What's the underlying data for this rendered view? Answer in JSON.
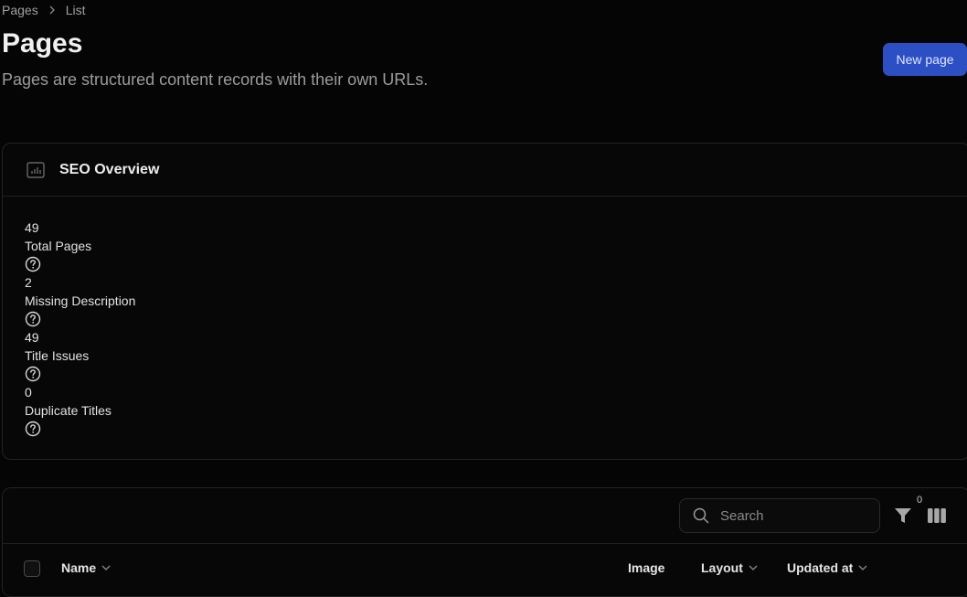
{
  "breadcrumb": {
    "items": [
      "Pages",
      "List"
    ]
  },
  "header": {
    "title": "Pages",
    "subtitle": "Pages are structured content records with their own URLs.",
    "new_button_label": "New page"
  },
  "seo": {
    "title": "SEO Overview",
    "icon": "chart-icon",
    "stats": [
      {
        "value": "49",
        "label": "Total Pages"
      },
      {
        "value": "2",
        "label": "Missing Description"
      },
      {
        "value": "49",
        "label": "Title Issues"
      },
      {
        "value": "0",
        "label": "Duplicate Titles"
      }
    ]
  },
  "table": {
    "search_placeholder": "Search",
    "filter_count": "0",
    "columns": [
      "Name",
      "Image",
      "Layout",
      "Updated at"
    ]
  },
  "colors": {
    "accent": "#2c4fc4",
    "background": "#050505"
  }
}
